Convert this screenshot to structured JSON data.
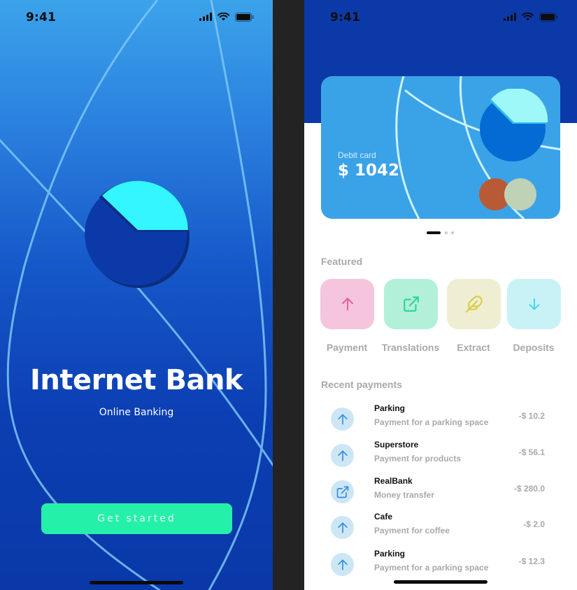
{
  "status_bar": {
    "time": "9:41"
  },
  "welcome": {
    "title": "Internet Bank",
    "subtitle": "Online Banking",
    "cta_label": "Get started"
  },
  "colors": {
    "primary_blue": "#0b3aa8",
    "card_blue": "#3aa3e8",
    "accent_green": "#25f0a9",
    "accent_cyan": "#35f7ff"
  },
  "card": {
    "label": "Debit card",
    "balance": "$ 1042"
  },
  "featured": {
    "title": "Featured",
    "items": [
      {
        "label": "Payment",
        "icon": "arrow-up-icon",
        "bg": "#f4c5dc",
        "fg": "#ee5c9a"
      },
      {
        "label": "Translations",
        "icon": "external-link-icon",
        "bg": "#b2f0d9",
        "fg": "#2fd397"
      },
      {
        "label": "Extract",
        "icon": "feather-icon",
        "bg": "#f0eed2",
        "fg": "#d6cf48"
      },
      {
        "label": "Deposits",
        "icon": "arrow-down-icon",
        "bg": "#c9f2f7",
        "fg": "#3ad8ee"
      }
    ]
  },
  "recent": {
    "title": "Recent payments",
    "items": [
      {
        "name": "Parking",
        "desc": "Payment for a parking space",
        "amount": "-$ 10.2",
        "icon": "arrow-up-icon"
      },
      {
        "name": "Superstore",
        "desc": "Payment for products",
        "amount": "-$ 56.1",
        "icon": "arrow-up-icon"
      },
      {
        "name": "RealBank",
        "desc": "Money transfer",
        "amount": "-$ 280.0",
        "icon": "external-link-icon"
      },
      {
        "name": "Cafe",
        "desc": "Payment for coffee",
        "amount": "-$ 2.0",
        "icon": "arrow-up-icon"
      },
      {
        "name": "Parking",
        "desc": "Payment for a parking space",
        "amount": "-$ 12.3",
        "icon": "arrow-up-icon"
      }
    ]
  }
}
